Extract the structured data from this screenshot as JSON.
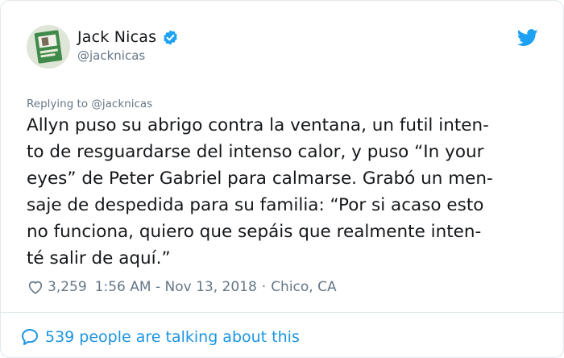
{
  "author": {
    "name": "Jack Nicas",
    "handle": "@jacknicas"
  },
  "reply_to": "Replying to @jacknicas",
  "tweet_lines": [
    "Allyn puso su abrigo contra la ventana, un futil inten-",
    "to de resguardarse del intenso calor, y puso “In your",
    "eyes” de Peter Gabriel para calmarse. Grabó un men-",
    "saje de despedida para su familia: “Por si acaso esto",
    "no funciona, quiero que sepáis que realmente inten-",
    "té salir de aquí.”"
  ],
  "meta": {
    "likes": "3,259",
    "timestamp": "1:56 AM - Nov 13, 2018",
    "separator": "·",
    "location": "Chico, CA"
  },
  "conversation": "539 people are talking about this",
  "icons": {
    "verified": "verified-badge-icon",
    "brand": "twitter-bird-icon",
    "like": "heart-icon",
    "reply": "speech-bubble-icon"
  },
  "colors": {
    "accent": "#1da1f2",
    "link": "#1b95e0",
    "muted": "#657786",
    "text": "#14171a"
  }
}
